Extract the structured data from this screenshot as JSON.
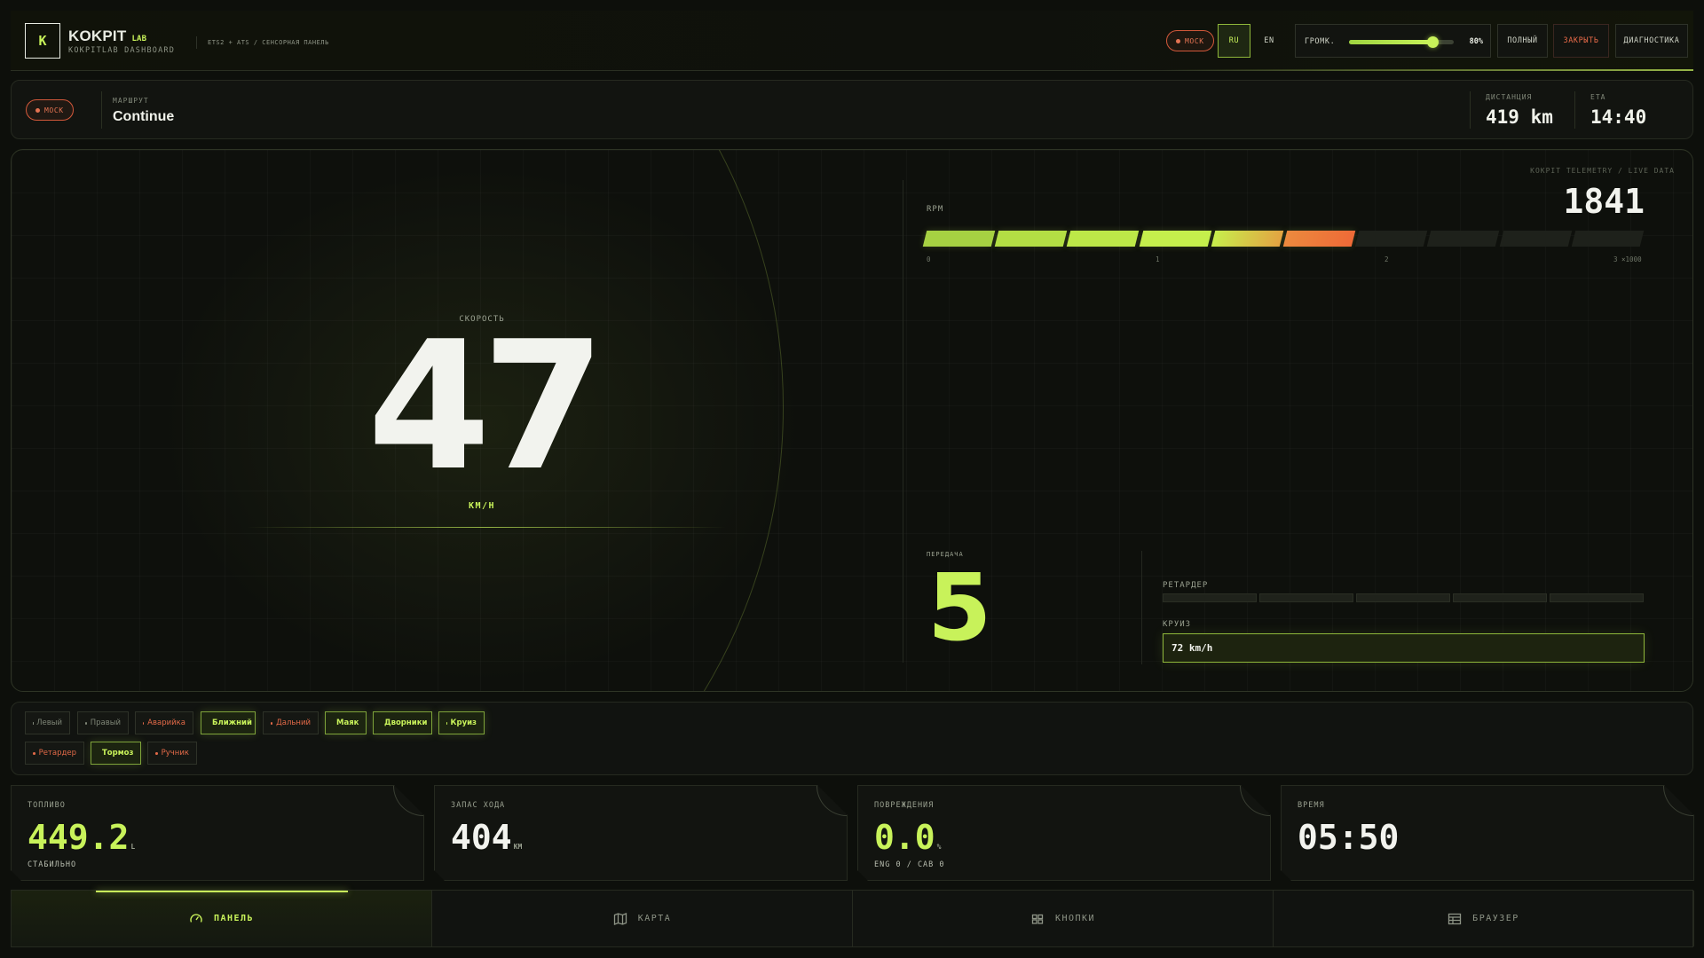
{
  "header": {
    "logo_letter": "K",
    "title": "KOKPIT",
    "title_suffix": "LAB",
    "subtitle": "KOKPITLAB DASHBOARD",
    "breadcrumb": "ETS2 + ATS / СЕНСОРНАЯ ПАНЕЛЬ",
    "mock_badge": "MOCK",
    "lang_ru": "RU",
    "lang_en": "EN",
    "volume_label": "ГРОМК.",
    "volume_value": "80%",
    "volume_fraction": 0.8,
    "btn_full": "ПОЛНЫЙ",
    "btn_close": "ЗАКРЫТЬ",
    "btn_diag": "ДИАГНОСТИКА"
  },
  "route": {
    "mock_badge": "MOCK",
    "route_label": "МАРШРУТ",
    "route_value": "Continue",
    "distance_label": "ДИСТАНЦИЯ",
    "distance_value": "419 km",
    "eta_label": "ETA",
    "eta_value": "14:40"
  },
  "main": {
    "speed_label": "СКОРОСТЬ",
    "speed_value": "47",
    "speed_unit": "КМ/Н",
    "telemetry_label": "KOKPIT TELEMETRY / LIVE DATA",
    "rpm_label": "RPM",
    "rpm_value": "1841",
    "rpm_fraction": 0.6,
    "rpm_segments_total": 10,
    "rpm_ticks": [
      "0",
      "1",
      "2",
      "3 ×1000"
    ],
    "gear_label": "ПЕРЕДАЧА",
    "gear_value": "5",
    "retarder_label": "РЕТАРДЕР",
    "retarder_level": 0,
    "retarder_segments": 5,
    "cruise_label": "КРУИЗ",
    "cruise_value": "72 km/h"
  },
  "toggles": [
    {
      "label": "Левый",
      "state": "off"
    },
    {
      "label": "Правый",
      "state": "off"
    },
    {
      "label": "Аварийка",
      "state": "warn"
    },
    {
      "label": "Ближний",
      "state": "on"
    },
    {
      "label": "Дальний",
      "state": "warn"
    },
    {
      "label": "Маяк",
      "state": "on"
    },
    {
      "label": "Дворники",
      "state": "on"
    },
    {
      "label": "Круиз",
      "state": "on"
    },
    {
      "label": "Ретардер",
      "state": "warn"
    },
    {
      "label": "Тормоз",
      "state": "on"
    },
    {
      "label": "Ручник",
      "state": "warn"
    }
  ],
  "cards": [
    {
      "label": "ТОПЛИВО",
      "value": "449.2",
      "unit": "L",
      "sub": "СТАБИЛЬНО",
      "accent": "#c8f25a"
    },
    {
      "label": "ЗАПАС ХОДА",
      "value": "404",
      "unit": "KM",
      "sub": "",
      "accent": "#f2f3ee"
    },
    {
      "label": "ПОВРЕЖДЕНИЯ",
      "value": "0.0",
      "unit": "%",
      "sub": "ENG 0 / CAB 0",
      "accent": "#c8f25a"
    },
    {
      "label": "ВРЕМЯ",
      "value": "05:50",
      "unit": "",
      "sub": "",
      "accent": "#f2f3ee"
    }
  ],
  "nav": [
    {
      "label": "ПАНЕЛЬ",
      "icon": "gauge-icon",
      "active": true
    },
    {
      "label": "КАРТА",
      "icon": "map-icon",
      "active": false
    },
    {
      "label": "КНОПКИ",
      "icon": "buttons-grid-icon",
      "active": false
    },
    {
      "label": "БРАУЗЕР",
      "icon": "browser-icon",
      "active": false
    }
  ],
  "colors": {
    "accent": "#c8f25a",
    "warning": "#e36a48",
    "background": "#0d0f0b"
  }
}
